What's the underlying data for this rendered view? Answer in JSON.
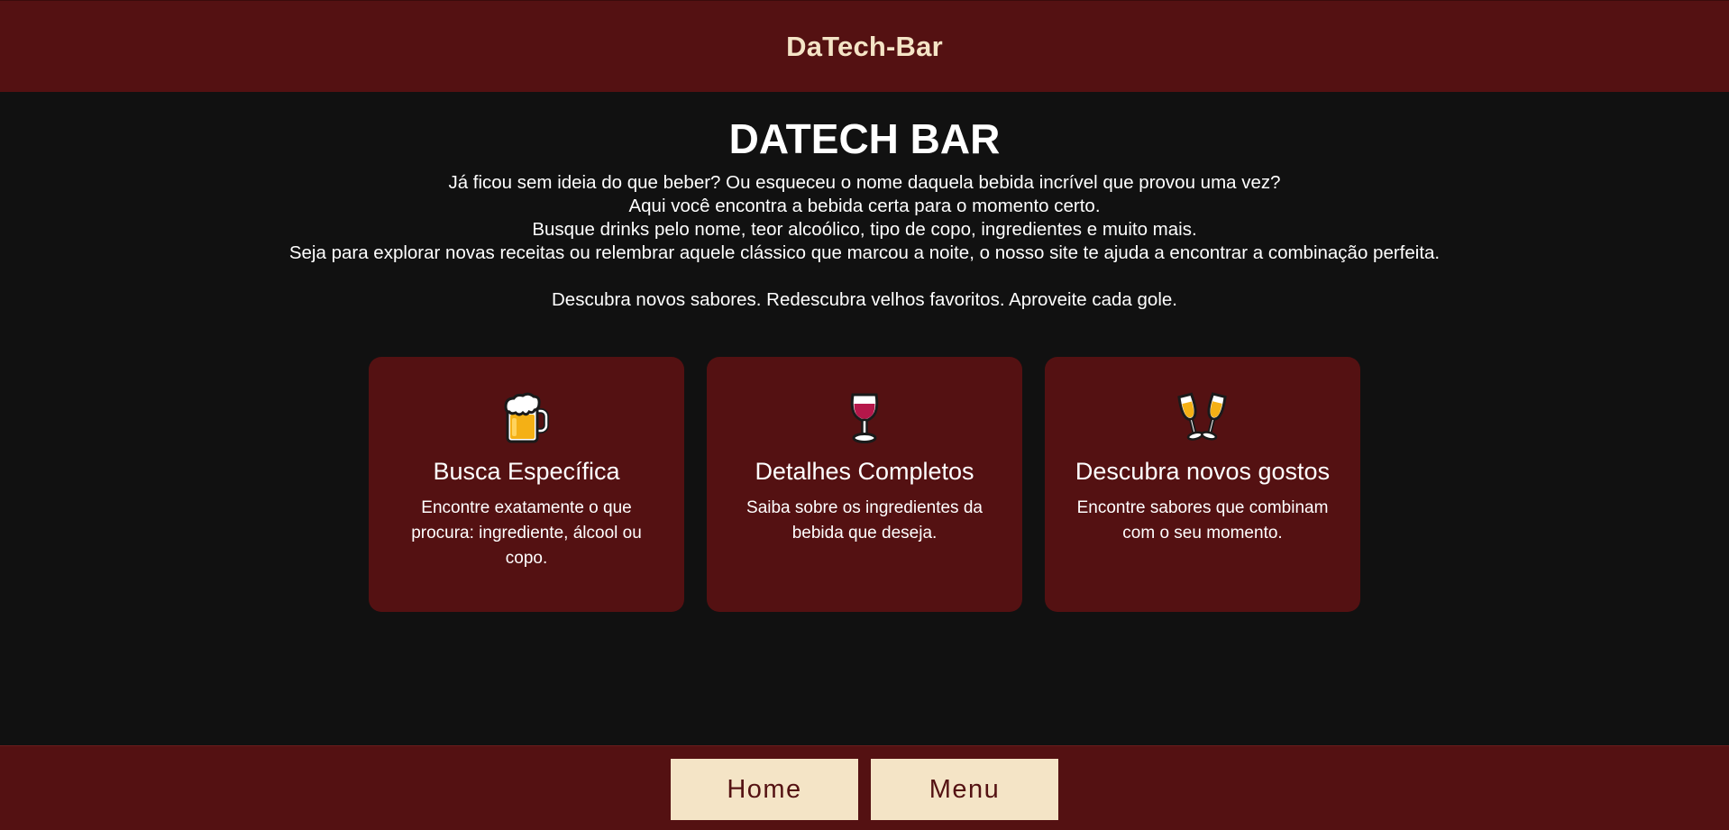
{
  "header": {
    "brand": "DaTech-Bar"
  },
  "hero": {
    "title": "DATECH BAR",
    "lines": [
      "Já ficou sem ideia do que beber? Ou esqueceu o nome daquela bebida incrível que provou uma vez?",
      "Aqui você encontra a bebida certa para o momento certo.",
      "Busque drinks pelo nome, teor alcoólico, tipo de copo, ingredientes e muito mais.",
      "Seja para explorar novas receitas ou relembrar aquele clássico que marcou a noite, o nosso site te ajuda a encontrar a combinação perfeita."
    ],
    "tagline": "Descubra novos sabores. Redescubra velhos favoritos. Aproveite cada gole."
  },
  "cards": [
    {
      "icon": "beer-mug-icon",
      "title": "Busca Específica",
      "text": "Encontre exatamente o que procura: ingrediente, álcool ou copo."
    },
    {
      "icon": "wine-glass-icon",
      "title": "Detalhes Completos",
      "text": "Saiba sobre os ingredientes da bebida que deseja."
    },
    {
      "icon": "clinking-glasses-icon",
      "title": "Descubra novos gostos",
      "text": "Encontre sabores que combinam com o seu momento."
    }
  ],
  "footer": {
    "home_label": "Home",
    "menu_label": "Menu"
  },
  "colors": {
    "background": "#111111",
    "bar": "#541112",
    "accent": "#f4e4c6"
  }
}
